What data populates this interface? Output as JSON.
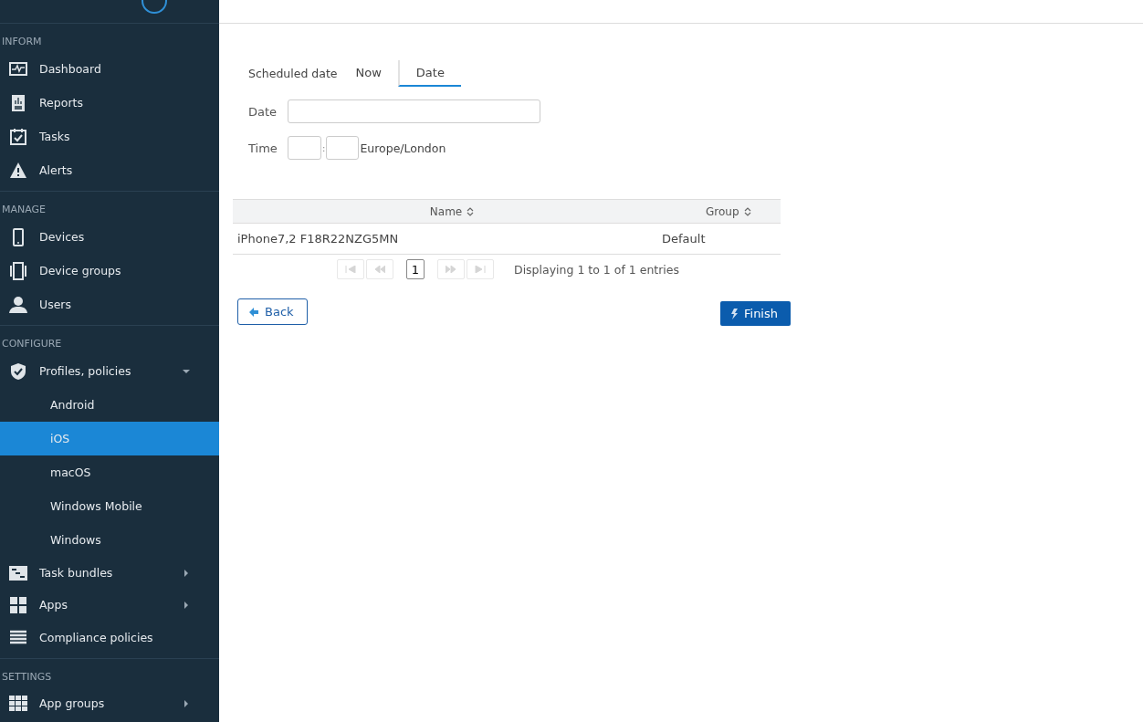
{
  "sidebar": {
    "sections": [
      {
        "title": "INFORM",
        "items": [
          {
            "label": "Dashboard",
            "selected": false
          },
          {
            "label": "Reports",
            "selected": false
          },
          {
            "label": "Tasks",
            "selected": false
          },
          {
            "label": "Alerts",
            "selected": false
          }
        ]
      },
      {
        "title": "MANAGE",
        "items": [
          {
            "label": "Devices",
            "selected": false
          },
          {
            "label": "Device groups",
            "selected": false
          },
          {
            "label": "Users",
            "selected": false
          }
        ]
      },
      {
        "title": "CONFIGURE",
        "items": [
          {
            "label": "Profiles, policies",
            "selected": false,
            "expanded": true,
            "children": [
              {
                "label": "Android",
                "selected": false
              },
              {
                "label": "iOS",
                "selected": true
              },
              {
                "label": "macOS",
                "selected": false
              },
              {
                "label": "Windows Mobile",
                "selected": false
              },
              {
                "label": "Windows",
                "selected": false
              }
            ]
          },
          {
            "label": "Task bundles",
            "selected": false,
            "expanded": false
          },
          {
            "label": "Apps",
            "selected": false,
            "expanded": false
          },
          {
            "label": "Compliance policies",
            "selected": false
          }
        ]
      },
      {
        "title": "SETTINGS",
        "items": [
          {
            "label": "App groups",
            "selected": false,
            "expanded": false
          }
        ]
      }
    ]
  },
  "schedule": {
    "label": "Scheduled date",
    "tabs": [
      {
        "label": "Now",
        "selected": false
      },
      {
        "label": "Date",
        "selected": true
      }
    ]
  },
  "date_field": {
    "label": "Date"
  },
  "time_field": {
    "label": "Time",
    "separator": ":",
    "timezone": "Europe/London"
  },
  "table": {
    "columns": [
      "Name",
      "Group"
    ],
    "rows": [
      [
        "iPhone7,2 F18R22NZG5MN",
        "Default"
      ]
    ]
  },
  "pager": {
    "pages": [
      {
        "label": "1",
        "selected": true
      }
    ],
    "first_disabled": true,
    "prev_disabled": true,
    "next_disabled": true,
    "last_disabled": true,
    "summary": "Displaying 1 to 1 of 1 entries"
  },
  "buttons": {
    "back": "Back",
    "finish": "Finish"
  }
}
